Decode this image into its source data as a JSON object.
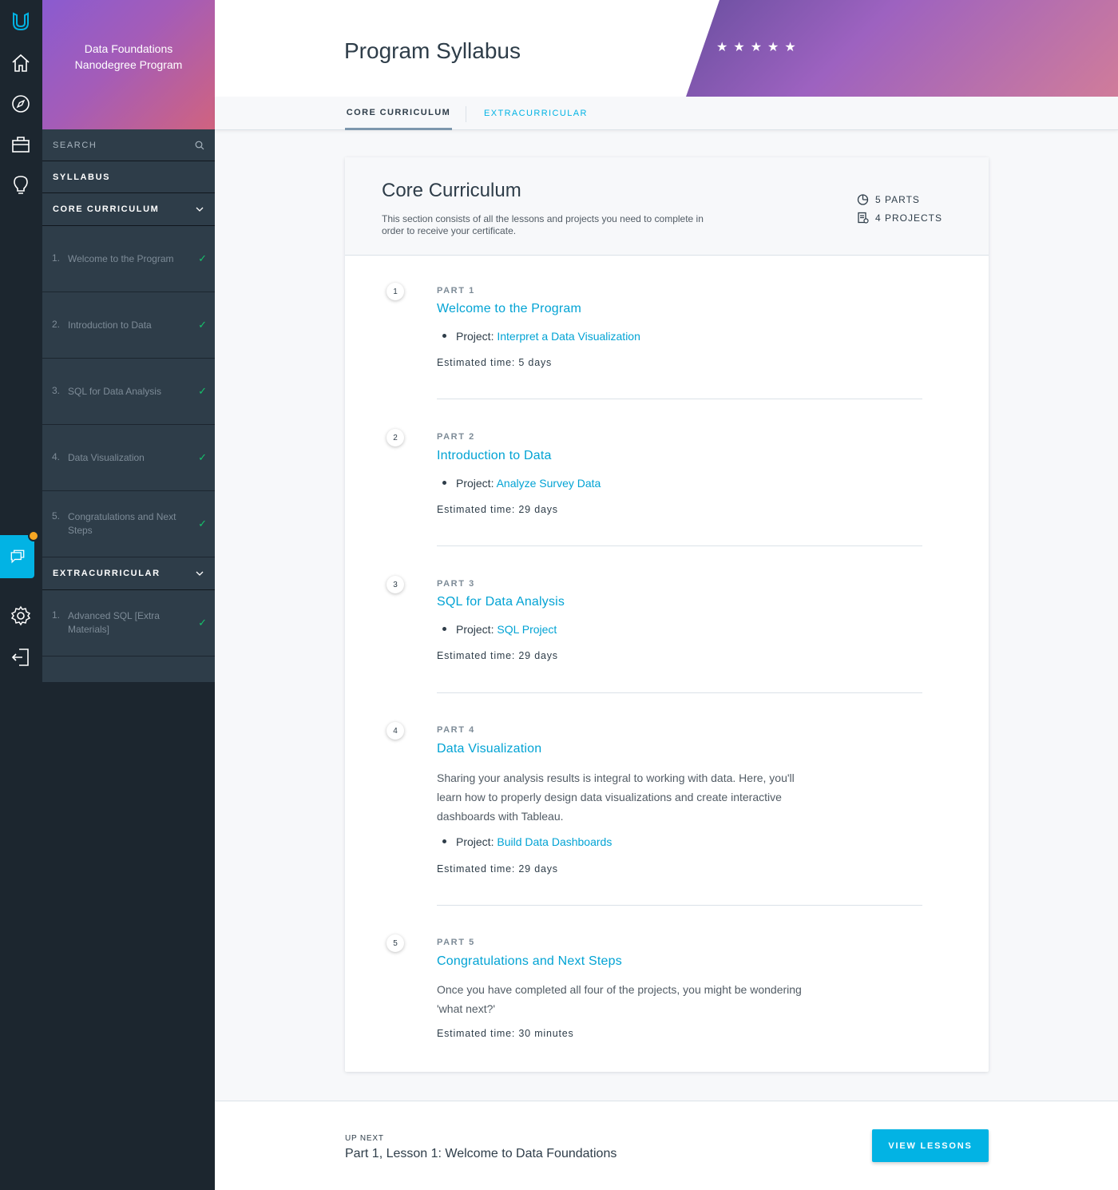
{
  "colors": {
    "accent": "#02b3e4",
    "rail": "#1c262f",
    "sidebar_row": "#2e3d49",
    "check": "#15c26b"
  },
  "rail": {
    "icons": [
      "udacity-logo-icon",
      "home-icon",
      "compass-icon",
      "briefcase-icon",
      "lightbulb-icon",
      "chat-icon",
      "gear-icon",
      "logout-icon"
    ]
  },
  "sidebar": {
    "program_title": "Data Foundations Nanodegree Program",
    "search_label": "SEARCH",
    "syllabus_label": "SYLLABUS",
    "core_label": "CORE CURRICULUM",
    "core_items": [
      {
        "num": "1.",
        "label": "Welcome to the Program"
      },
      {
        "num": "2.",
        "label": "Introduction to Data"
      },
      {
        "num": "3.",
        "label": "SQL for Data Analysis"
      },
      {
        "num": "4.",
        "label": "Data Visualization"
      },
      {
        "num": "5.",
        "label": "Congratulations and Next Steps"
      }
    ],
    "extra_label": "EXTRACURRICULAR",
    "extra_items": [
      {
        "num": "1.",
        "label": "Advanced SQL [Extra Materials]"
      }
    ],
    "check_glyph": "✓"
  },
  "header": {
    "title": "Program Syllabus",
    "rating_stars": 5,
    "star_glyph": "★"
  },
  "tabs": {
    "core": "CORE CURRICULUM",
    "extra": "EXTRACURRICULAR"
  },
  "card": {
    "title": "Core Curriculum",
    "description": "This section consists of all the lessons and projects you need to complete in order to receive your certificate.",
    "parts_count": "5 PARTS",
    "projects_count": "4 PROJECTS"
  },
  "parts": [
    {
      "num": "1",
      "label": "PART 1",
      "title": "Welcome to the Program",
      "description": "",
      "project_prefix": "Project:",
      "project": "Interpret a Data Visualization",
      "estimate": "Estimated time: 5 days"
    },
    {
      "num": "2",
      "label": "PART 2",
      "title": "Introduction to Data",
      "description": "",
      "project_prefix": "Project:",
      "project": "Analyze Survey Data",
      "estimate": "Estimated time: 29 days"
    },
    {
      "num": "3",
      "label": "PART 3",
      "title": "SQL for Data Analysis",
      "description": "",
      "project_prefix": "Project:",
      "project": "SQL Project",
      "estimate": "Estimated time: 29 days"
    },
    {
      "num": "4",
      "label": "PART 4",
      "title": "Data Visualization",
      "description": "Sharing your analysis results is integral to working with data. Here, you'll learn how to properly design data visualizations and create interactive dashboards with Tableau.",
      "project_prefix": "Project:",
      "project": "Build Data Dashboards",
      "estimate": "Estimated time: 29 days"
    },
    {
      "num": "5",
      "label": "PART 5",
      "title": "Congratulations and Next Steps",
      "description": "Once you have completed all four of the projects, you might be wondering 'what next?'",
      "project_prefix": "",
      "project": "",
      "estimate": "Estimated time: 30 minutes"
    }
  ],
  "footer": {
    "up_next_label": "UP NEXT",
    "next_lesson": "Part 1, Lesson 1: Welcome to Data Foundations",
    "button": "VIEW LESSONS"
  }
}
